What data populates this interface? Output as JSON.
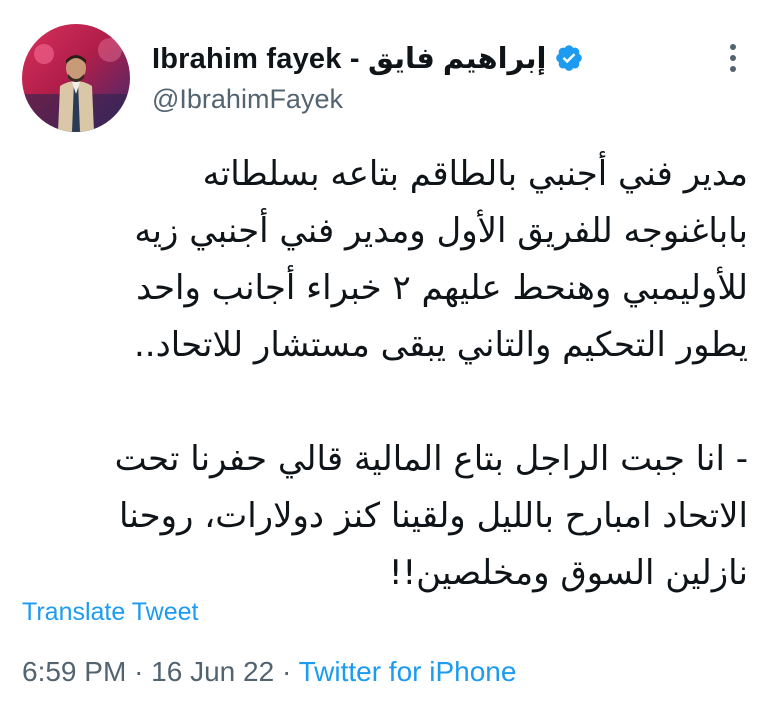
{
  "author": {
    "display_name": "Ibrahim fayek - إبراهيم فايق",
    "handle": "@IbrahimFayek",
    "verified": true
  },
  "tweet": {
    "lines": [
      "مدير فني أجنبي بالطاقم بتاعه بسلطاته",
      "باباغنوجه للفريق الأول ومدير فني أجنبي زيه",
      "للأوليمبي وهنحط عليهم ٢ خبراء أجانب واحد",
      "يطور التحكيم والتاني يبقى مستشار للاتحاد..",
      "",
      "- انا جبت الراجل بتاع المالية قالي حفرنا تحت",
      "الاتحاد امبارح بالليل ولقينا كنز دولارات، روحنا",
      "نازلين السوق ومخلصين!!"
    ],
    "translate_label": "Translate Tweet",
    "time": "6:59 PM",
    "separator": "·",
    "date": "16 Jun 22",
    "source": "Twitter for iPhone"
  },
  "icons": {
    "verified": "verified-badge-icon",
    "more": "more-options-icon"
  },
  "colors": {
    "accent": "#1d9bf0",
    "text": "#0f1419",
    "muted": "#536471"
  }
}
